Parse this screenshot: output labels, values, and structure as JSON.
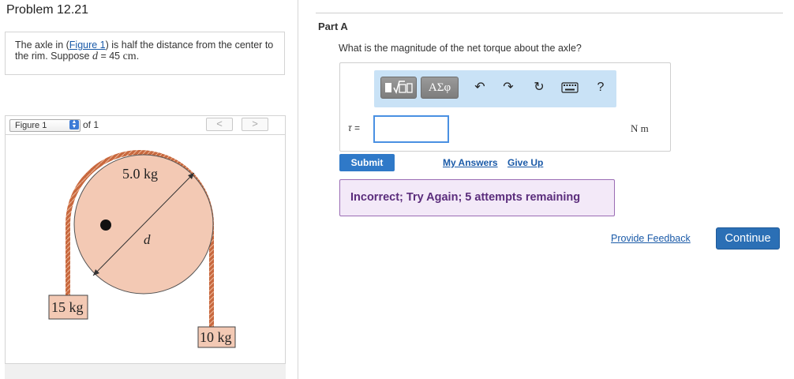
{
  "problem": {
    "title": "Problem 12.21",
    "text_prefix": "The axle in (",
    "figure_link": "Figure 1",
    "text_mid": ") is half the distance from the center to the rim. Suppose ",
    "var_d": "d",
    "text_value": " = 45 ",
    "text_unit": "cm",
    "text_end": "."
  },
  "figure": {
    "select_value": "Figure 1",
    "of_label": "of 1",
    "prev_label": "<",
    "next_label": ">",
    "wheel_mass": "5.0 kg",
    "diameter_label": "d",
    "left_mass": "15 kg",
    "right_mass": "10 kg"
  },
  "part": {
    "label": "Part A",
    "question": "What is the magnitude of the net torque about the axle?"
  },
  "answer": {
    "toolbar": {
      "greek_label": "ΑΣφ",
      "help_label": "?",
      "icons": [
        "template-icon",
        "greek-icon",
        "undo-icon",
        "redo-icon",
        "reset-icon",
        "keyboard-icon",
        "help-icon"
      ]
    },
    "var_label": "τ =",
    "input_value": "",
    "units": "N m"
  },
  "actions": {
    "submit": "Submit",
    "my_answers": "My Answers",
    "give_up": "Give Up",
    "feedback": "Incorrect; Try Again; 5 attempts remaining",
    "provide_feedback": "Provide Feedback",
    "continue": "Continue"
  },
  "colors": {
    "accent_blue": "#2f79c8",
    "toolbar_bg": "#c9e2f6",
    "feedback_bg": "#f3e9f8",
    "feedback_text": "#5b2d7c",
    "wheel_fill": "#f3c9b4",
    "rope": "#c8683e"
  }
}
